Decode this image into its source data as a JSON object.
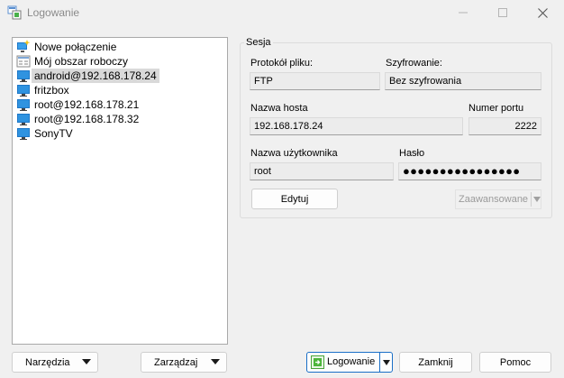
{
  "window": {
    "title": "Logowanie"
  },
  "tree": {
    "items": [
      {
        "label": "Nowe połączenie",
        "icon": "new-site-icon"
      },
      {
        "label": "Mój obszar roboczy",
        "icon": "workspace-icon"
      },
      {
        "label": "android@192.168.178.24",
        "icon": "monitor-icon",
        "selected": true
      },
      {
        "label": "fritzbox",
        "icon": "monitor-icon"
      },
      {
        "label": "root@192.168.178.21",
        "icon": "monitor-icon"
      },
      {
        "label": "root@192.168.178.32",
        "icon": "monitor-icon"
      },
      {
        "label": "SonyTV",
        "icon": "monitor-icon"
      }
    ]
  },
  "session": {
    "group_title": "Sesja",
    "protocol_label": "Protokół pliku:",
    "protocol_value": "FTP",
    "encryption_label": "Szyfrowanie:",
    "encryption_value": "Bez szyfrowania",
    "host_label": "Nazwa hosta",
    "host_value": "192.168.178.24",
    "port_label": "Numer portu",
    "port_value": "2222",
    "user_label": "Nazwa użytkownika",
    "user_value": "root",
    "password_label": "Hasło",
    "password_value": "●●●●●●●●●●●●●●●●",
    "edit_button": "Edytuj",
    "advanced_button": "Zaawansowane"
  },
  "footer": {
    "tools_button": "Narzędzia",
    "manage_button": "Zarządzaj",
    "login_button": "Logowanie",
    "close_button": "Zamknij",
    "help_button": "Pomoc"
  },
  "colors": {
    "accent": "#1a6fc7",
    "monitor": "#1e78c8",
    "window_bg": "#f0f0f0"
  }
}
